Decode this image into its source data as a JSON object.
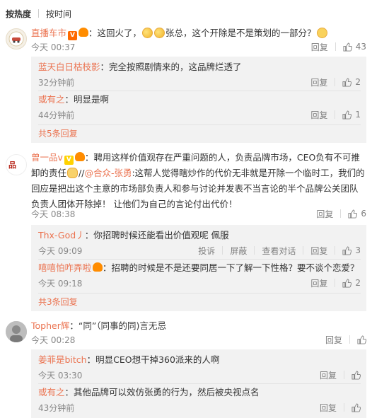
{
  "sort": {
    "hot": "按热度",
    "time": "按时间"
  },
  "actions": {
    "reply": "回复"
  },
  "comments": [
    {
      "user": "直播车市",
      "text1": "：这回火了，",
      "text2": "张总，这个开除是不是策划的一部分？",
      "time": "今天 00:37",
      "likes": "43",
      "replies": [
        {
          "user": "蓝天白日枯枝影",
          "text": "：完全按照剧情来的，这品牌烂透了",
          "time": "32分钟前",
          "likes": "2"
        },
        {
          "user": "或有之",
          "text": "：明显是啊",
          "time": "44分钟前",
          "likes": "1"
        }
      ],
      "more": "共5条回复"
    },
    {
      "user": "曾一品v",
      "text1": "：聘用这样价值观存在严重问题的人，负责品牌市场，CEO负有不可推卸的责任",
      "sep": "//",
      "mention": "@合众-张勇",
      "text2": ":这帮人觉得瞎炒作的代价无非就是开除一个临时工，我们的回应是把出这个主意的市场部负责人和参与讨论并发表不当言论的半个品牌公关团队负责人团体开除掉！ 让他们为自己的言论付出代价！",
      "time": "今天 08:38",
      "likes": "6",
      "replies": [
        {
          "user": "Thx-God丿",
          "text": "：你招聘时候还能看出价值观呢 佩服",
          "time": "今天 09:09",
          "likes": "3",
          "extra": [
            "投诉",
            "屏蔽",
            "查看对话"
          ]
        },
        {
          "user": "嘻嘻怕咋弄啦",
          "text": "：招聘的时候是不是还要同居一下了解一下性格？要不谈个恋爱？",
          "time": "今天 09:18",
          "likes": "2"
        }
      ],
      "more": "共3条回复"
    },
    {
      "user": "Topher辉",
      "text1": "：“同”（同事的同)言无忌",
      "time": "今天 00:28",
      "likes": "",
      "replies": [
        {
          "user": "姜菲是bitch",
          "text": "：明显CEO想干掉360派来的人啊",
          "time": "今天 03:30",
          "likes": ""
        },
        {
          "user": "或有之",
          "text": "：其他品牌可以效仿张勇的行为，然后被央视点名",
          "time": "43分钟前",
          "likes": ""
        }
      ]
    }
  ],
  "colors": {
    "link": "#eb7350",
    "meta": "#888888",
    "subBg": "#f2f2f2"
  }
}
